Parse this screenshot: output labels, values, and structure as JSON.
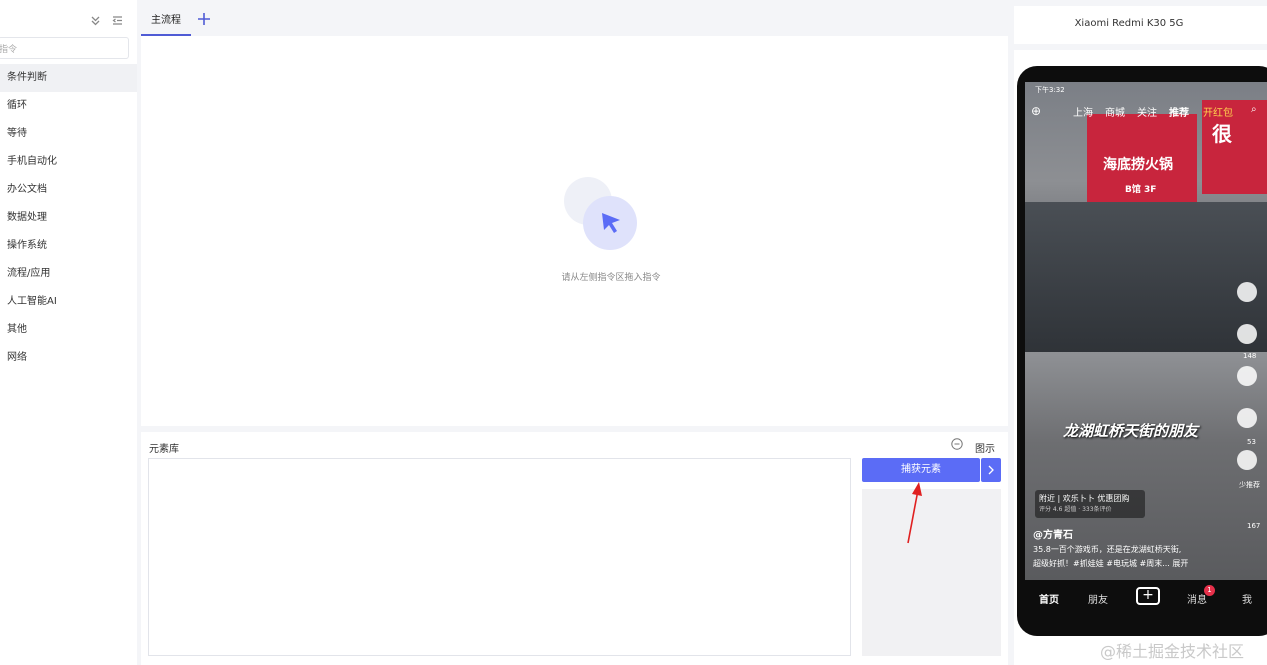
{
  "sidebar": {
    "search_placeholder": "指令",
    "items": [
      "条件判断",
      "循环",
      "等待",
      "手机自动化",
      "办公文档",
      "数据处理",
      "操作系统",
      "流程/应用",
      "人工智能AI",
      "其他",
      "网络"
    ]
  },
  "tabs": {
    "main_label": "主流程"
  },
  "canvas": {
    "empty_hint": "请从左侧指令区拖入指令"
  },
  "element_library": {
    "title": "元素库",
    "show_label": "图示",
    "capture_label": "捕获元素"
  },
  "device": {
    "title": "Xiaomi Redmi K30 5G",
    "status_time": "下午3:32",
    "top_nav": [
      "上海",
      "商城",
      "关注",
      "推荐",
      "开红包"
    ],
    "sign_main": "海底捞火锅",
    "sign_floor": "B馆 3F",
    "sign_right": "很",
    "caption": "龙湖虹桥天街的朋友",
    "poi_title": "附近 | 欢乐卜卜 优惠团购",
    "poi_sub": "评分 4.6 超值 · 333条评价",
    "author": "@方青石",
    "description_line1": "35.8一百个游戏币，还是在龙湖虹桥天街,",
    "description_line2": "超级好抓！#抓娃娃 #电玩城 #周末... 展开",
    "bottom_nav": [
      "首页",
      "朋友",
      "消息",
      "我"
    ],
    "message_badge": "1",
    "like_count": "148",
    "star_count": "53",
    "share_count": "167",
    "dislike_label": "少推荐"
  },
  "watermark": "@稀土掘金技术社区",
  "colors": {
    "accent": "#5b6cf6",
    "tab_underline": "#4f5bd5",
    "arrow_red": "#e02020"
  }
}
